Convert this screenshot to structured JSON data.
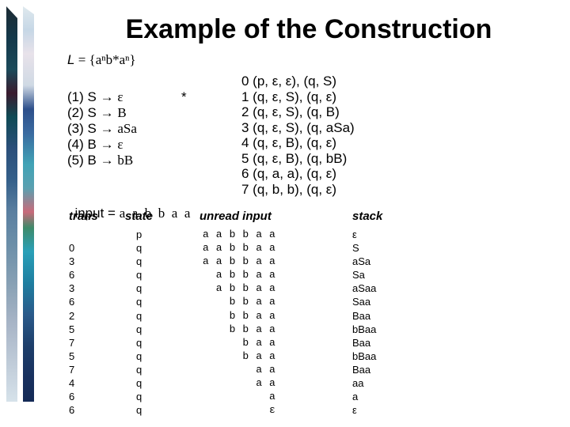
{
  "title": "Example of the Construction",
  "language": {
    "prefix": "L",
    "definition": " = {aⁿb*aⁿ}"
  },
  "rules": [
    {
      "num": "(1)",
      "lhs": "S",
      "arrow": "→",
      "rhs": "ε"
    },
    {
      "num": "(2)",
      "lhs": "S",
      "arrow": "→",
      "rhs": "B"
    },
    {
      "num": "(3)",
      "lhs": "S",
      "arrow": "→",
      "rhs": "aSa"
    },
    {
      "num": "(4)",
      "lhs": "B",
      "arrow": "→",
      "rhs": "ε"
    },
    {
      "num": "(5)",
      "lhs": "B",
      "arrow": "→",
      "rhs": "bB"
    }
  ],
  "star_marker": "*",
  "input": {
    "label": "input = ",
    "value": "a  a  b  b  a  a"
  },
  "transitions": [
    "0 (p, ε, ε), (q, S)",
    "1 (q, ε, S), (q, ε)",
    "2 (q, ε, S), (q, B)",
    "3 (q, ε, S), (q, aSa)",
    "4 (q, ε, B), (q, ε)",
    "5 (q, ε, B), (q, bB)",
    "6 (q, a, a), (q, ε)",
    "7 (q, b, b), (q, ε)"
  ],
  "trace": {
    "headers": {
      "trans": "trans",
      "state": "state",
      "input": "unread input",
      "stack": "stack"
    },
    "rows": [
      {
        "trans": "",
        "state": "p",
        "input": "a a b b a a",
        "stack": "ε"
      },
      {
        "trans": "0",
        "state": "q",
        "input": "a a b b a a",
        "stack": "S"
      },
      {
        "trans": "3",
        "state": "q",
        "input": "a a b b a a",
        "stack": "aSa"
      },
      {
        "trans": "6",
        "state": "q",
        "input": "  a b b a a",
        "stack": "Sa"
      },
      {
        "trans": "3",
        "state": "q",
        "input": "  a b b a a",
        "stack": "aSaa"
      },
      {
        "trans": "6",
        "state": "q",
        "input": "    b b a a",
        "stack": "Saa"
      },
      {
        "trans": "2",
        "state": "q",
        "input": "    b b a a",
        "stack": "Baa"
      },
      {
        "trans": "5",
        "state": "q",
        "input": "    b b a a",
        "stack": "bBaa"
      },
      {
        "trans": "7",
        "state": "q",
        "input": "      b a a",
        "stack": "Baa"
      },
      {
        "trans": "5",
        "state": "q",
        "input": "      b a a",
        "stack": "bBaa"
      },
      {
        "trans": "7",
        "state": "q",
        "input": "        a a",
        "stack": "Baa"
      },
      {
        "trans": "4",
        "state": "q",
        "input": "        a a",
        "stack": "aa"
      },
      {
        "trans": "6",
        "state": "q",
        "input": "          a",
        "stack": "a"
      },
      {
        "trans": "6",
        "state": "q",
        "input": "          ε",
        "stack": "ε"
      }
    ]
  }
}
